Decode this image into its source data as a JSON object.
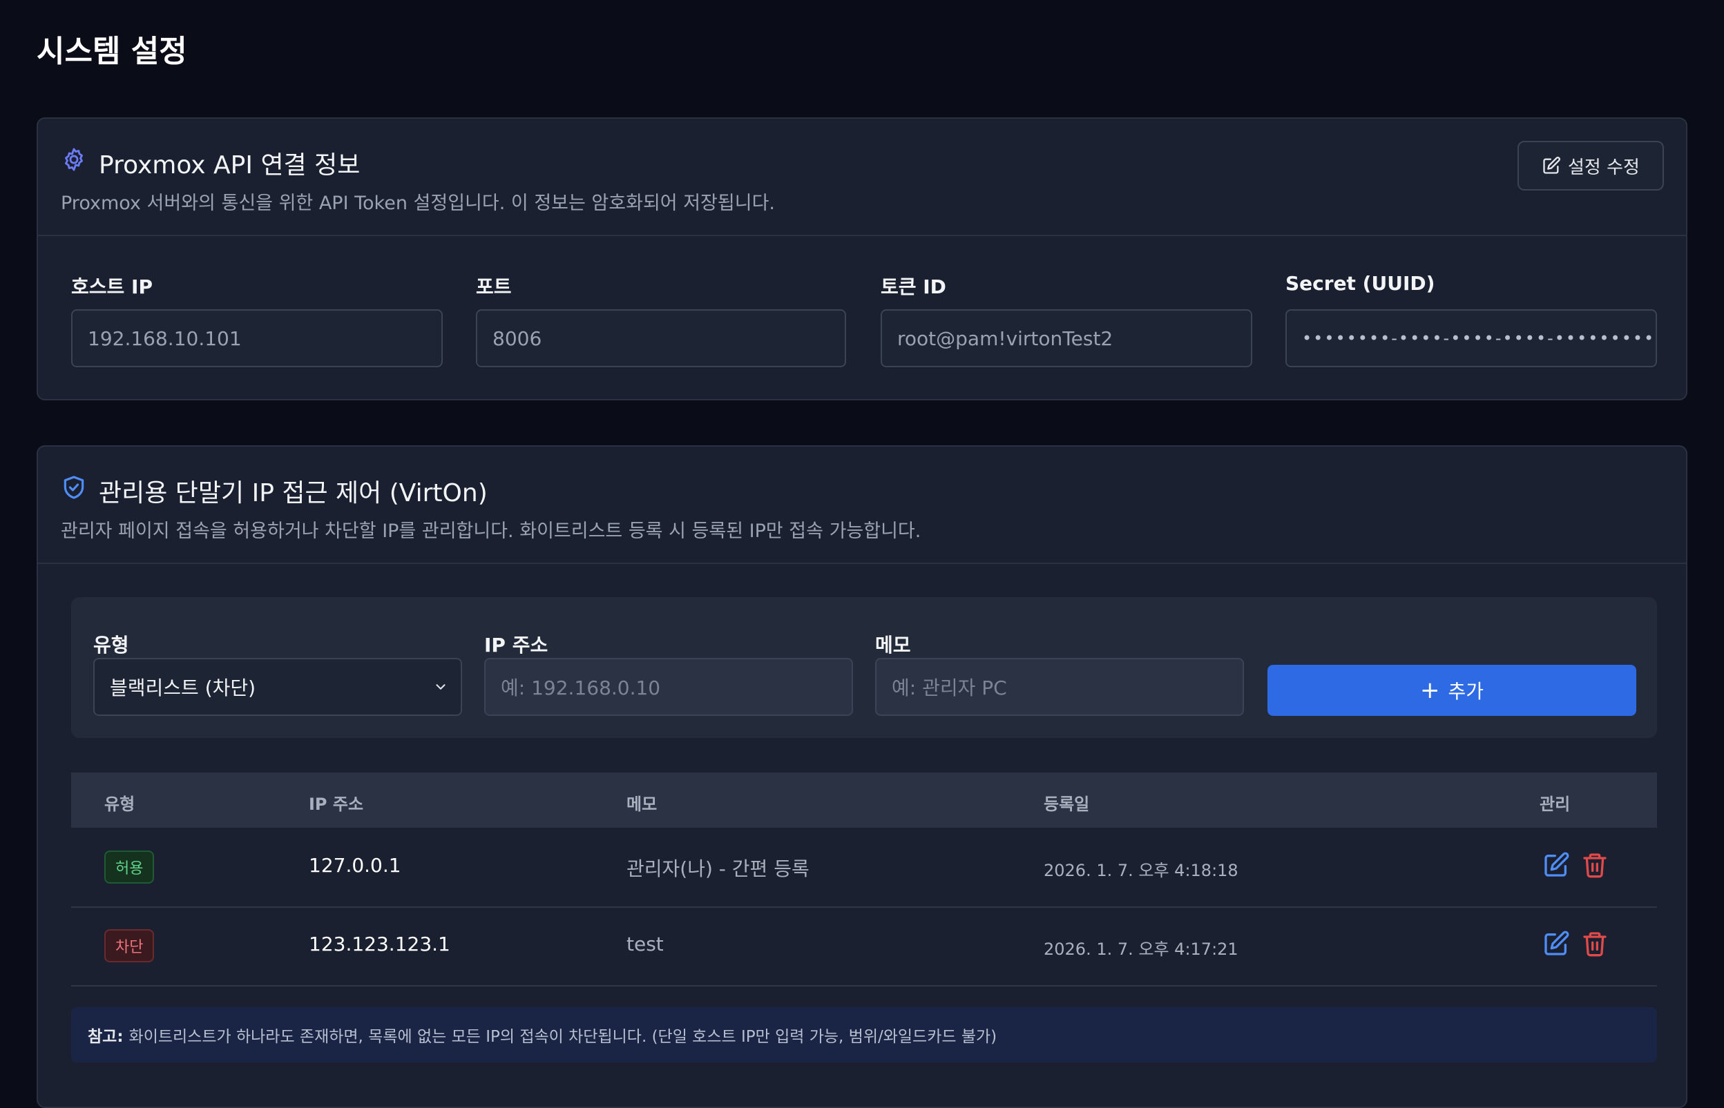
{
  "page": {
    "title": "시스템 설정"
  },
  "api_section": {
    "title": "Proxmox API 연결 정보",
    "description": "Proxmox 서버와의 통신을 위한 API Token 설정입니다. 이 정보는 암호화되어 저장됩니다.",
    "edit_button": "설정 수정",
    "icon": "gear-icon",
    "fields": [
      {
        "label": "호스트 IP",
        "value": "192.168.10.101"
      },
      {
        "label": "포트",
        "value": "8006"
      },
      {
        "label": "토큰 ID",
        "value": "root@pam!virtonTest2"
      },
      {
        "label": "Secret (UUID)",
        "value": "••••••••-••••-••••-••••-••••••••••••"
      }
    ]
  },
  "ip_section": {
    "title": "관리용 단말기 IP 접근 제어 (VirtOn)",
    "description": "관리자 페이지 접속을 허용하거나 차단할 IP를 관리합니다. 화이트리스트 등록 시 등록된 IP만 접속 가능합니다.",
    "icon": "shield-check-icon",
    "form": {
      "type_label": "유형",
      "type_value": "블랙리스트 (차단)",
      "ip_label": "IP 주소",
      "ip_placeholder": "예: 192.168.0.10",
      "memo_label": "메모",
      "memo_placeholder": "예: 관리자 PC",
      "add_button": "추가",
      "add_icon": "+"
    },
    "table": {
      "headers": [
        "유형",
        "IP 주소",
        "메모",
        "등록일",
        "관리"
      ],
      "rows": [
        {
          "type": "허용",
          "ip": "127.0.0.1",
          "memo": "관리자(나) - 간편 등록",
          "date": "2026. 1. 7. 오후 4:18:18"
        },
        {
          "type": "차단",
          "ip": "123.123.123.1",
          "memo": "test",
          "date": "2026. 1. 7. 오후 4:17:21"
        }
      ]
    },
    "note": {
      "label": "참고:",
      "text": "화이트리스트가 하나라도 존재하면, 목록에 없는 모든 IP의 접속이 차단됩니다. (단일 호스트 IP만 입력 가능, 범위/와일드카드 불가)"
    }
  },
  "colors": {
    "background": "#0a0d18",
    "card": "#1a2030",
    "accent": "#2d6ae3",
    "allow": "#5fd38a",
    "block": "#f0727c",
    "delete": "#e04a4a"
  }
}
